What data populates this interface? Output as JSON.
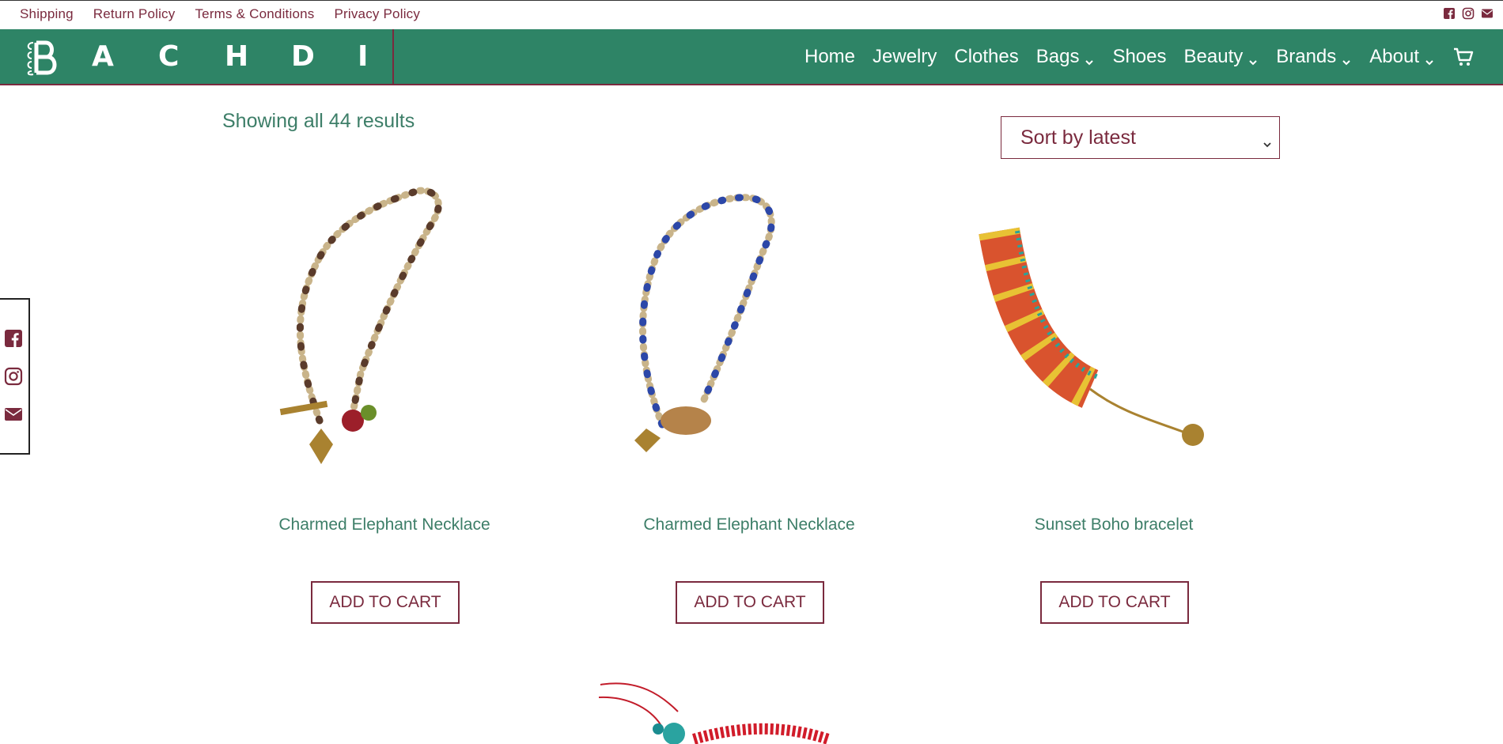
{
  "topbar": {
    "links": [
      "Shipping",
      "Return Policy",
      "Terms & Conditions",
      "Privacy Policy"
    ],
    "social_icons": [
      "facebook-icon",
      "instagram-icon",
      "envelope-icon"
    ]
  },
  "header": {
    "logo_letters": [
      "A",
      "C",
      "H",
      "D",
      "I"
    ],
    "nav": {
      "home": "Home",
      "jewelry": "Jewelry",
      "clothes": "Clothes",
      "bags": "Bags",
      "shoes": "Shoes",
      "beauty": "Beauty",
      "brands": "Brands",
      "about": "About"
    }
  },
  "catalog": {
    "results_text": "Showing all 44 results",
    "sort_value": "Sort by latest",
    "products": [
      {
        "title": "Charmed Elephant Necklace",
        "button": "ADD TO CART"
      },
      {
        "title": "Charmed Elephant Necklace",
        "button": "ADD TO CART"
      },
      {
        "title": "Sunset Boho bracelet",
        "button": "ADD TO CART"
      }
    ]
  },
  "colors": {
    "brand_green": "#2e8466",
    "accent_burgundy": "#7a2a3e",
    "text_green": "#3d7e68"
  }
}
